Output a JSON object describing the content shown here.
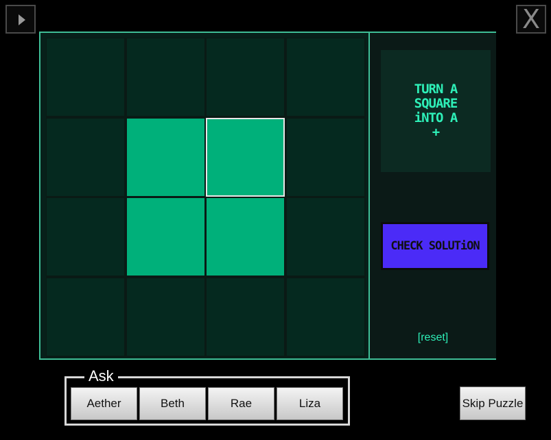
{
  "controls": {
    "play_icon": "play-triangle",
    "close_label": "X"
  },
  "puzzle": {
    "rows": 4,
    "cols": 4,
    "cells": [
      [
        0,
        0,
        0,
        0
      ],
      [
        0,
        1,
        1,
        0
      ],
      [
        0,
        1,
        1,
        0
      ],
      [
        0,
        0,
        0,
        0
      ]
    ],
    "selected": [
      1,
      2
    ],
    "colors": {
      "on": "#00b07a",
      "off": "#05291f",
      "border": "#3fbf97",
      "accent": "#2ef0b8",
      "check": "#4b2bf7"
    }
  },
  "sidebar": {
    "instruction_lines": [
      "TURN A",
      "SQUARE",
      "iNTO A",
      "+"
    ],
    "check_label": "CHECK SOLUTiON",
    "reset_label": "[reset]"
  },
  "ask": {
    "label": "Ask",
    "buttons": [
      "Aether",
      "Beth",
      "Rae",
      "Liza"
    ]
  },
  "skip_label": "Skip Puzzle"
}
